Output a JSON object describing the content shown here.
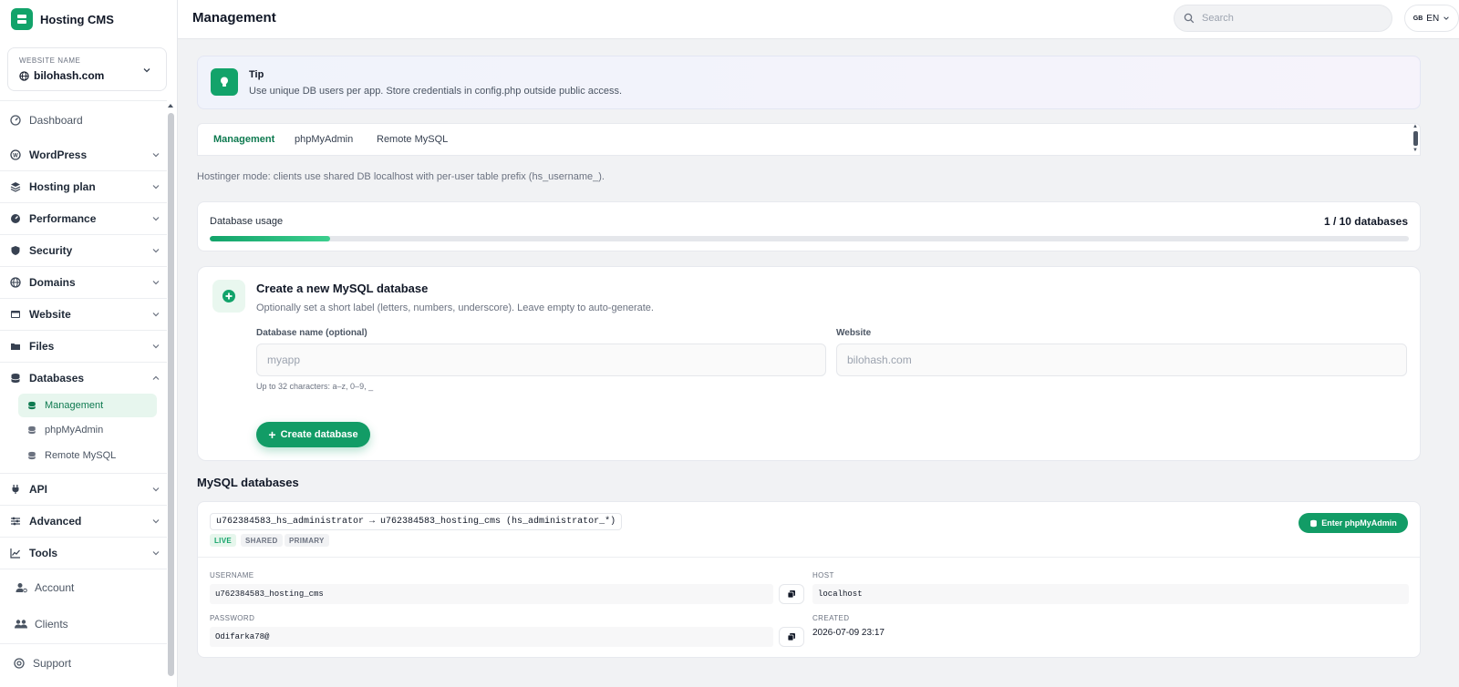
{
  "app": {
    "name": "Hosting CMS"
  },
  "website_selector": {
    "label": "WEBSITE NAME",
    "value": "bilohash.com"
  },
  "nav": {
    "dashboard": "Dashboard",
    "wordpress": "WordPress",
    "hosting_plan": "Hosting plan",
    "performance": "Performance",
    "security": "Security",
    "domains": "Domains",
    "website": "Website",
    "files": "Files",
    "databases": "Databases",
    "databases_sub": [
      "Management",
      "phpMyAdmin",
      "Remote MySQL"
    ],
    "api": "API",
    "advanced": "Advanced",
    "tools": "Tools",
    "account": "Account",
    "clients": "Clients",
    "support": "Support"
  },
  "header": {
    "title": "Management",
    "search_placeholder": "Search",
    "lang_flag": "GB",
    "lang": "EN"
  },
  "tip": {
    "title": "Tip",
    "text": "Use unique DB users per app. Store credentials in config.php outside public access."
  },
  "tabs": [
    "Management",
    "phpMyAdmin",
    "Remote MySQL"
  ],
  "mode_note": "Hostinger mode: clients use shared DB localhost with per-user table prefix (hs_username_).",
  "usage": {
    "label": "Database usage",
    "value": "1 / 10 databases",
    "used": 1,
    "total": 10
  },
  "create": {
    "title": "Create a new MySQL database",
    "subtitle": "Optionally set a short label (letters, numbers, underscore). Leave empty to auto-generate.",
    "name_label": "Database name (optional)",
    "name_placeholder": "myapp",
    "website_label": "Website",
    "website_value": "bilohash.com",
    "hint": "Up to 32 characters: a–z, 0–9, _",
    "button": "Create database"
  },
  "databases": {
    "section_title": "MySQL databases",
    "items": [
      {
        "name": "u762384583_hs_administrator → u762384583_hosting_cms (hs_administrator_*)",
        "badges": [
          "LIVE",
          "SHARED",
          "PRIMARY"
        ],
        "enter_label": "Enter phpMyAdmin",
        "username_label": "USERNAME",
        "username": "u762384583_hosting_cms",
        "host_label": "HOST",
        "host": "localhost",
        "password_label": "PASSWORD",
        "password": "Odifarka78@",
        "created_label": "CREATED",
        "created": "2026-07-09 23:17"
      }
    ]
  },
  "colors": {
    "accent": "#12a36a",
    "accent_dark": "#0e7a50"
  }
}
